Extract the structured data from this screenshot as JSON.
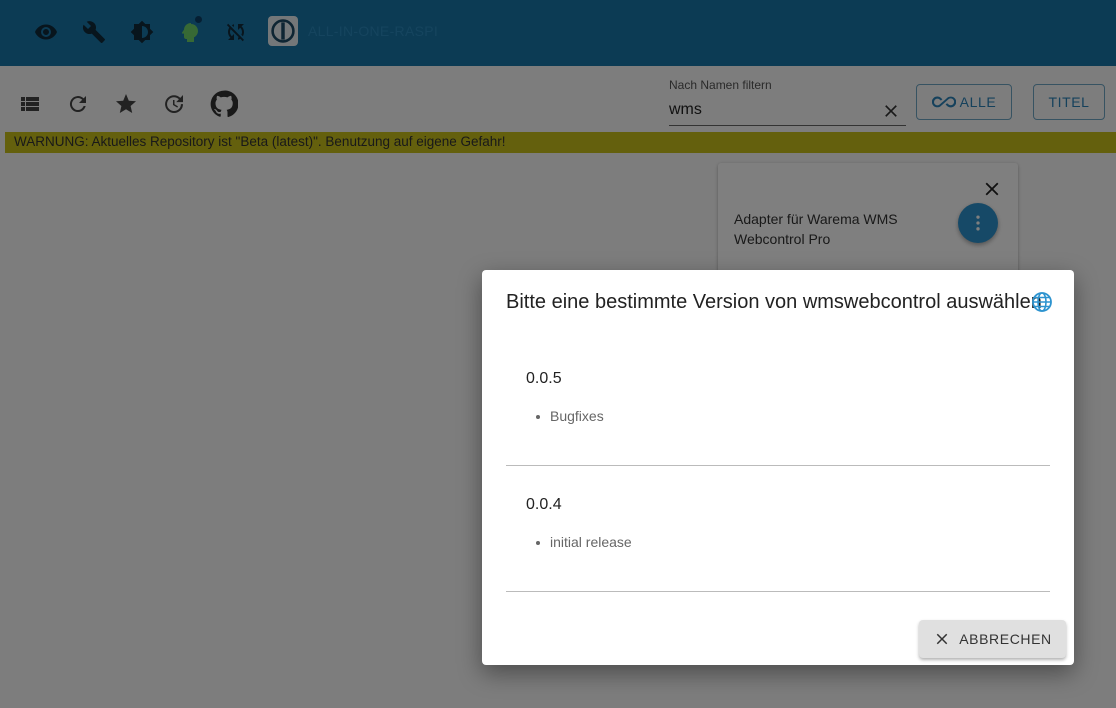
{
  "appbar": {
    "icons": [
      "eye-icon",
      "wrench-icon",
      "brightness-icon",
      "head-icon",
      "sync-off-icon"
    ],
    "host_name": "ALL-IN-ONE-RASPI"
  },
  "toolbar": {
    "icons": [
      "list-icon",
      "refresh-icon",
      "star-icon",
      "update-icon",
      "github-icon"
    ],
    "filter": {
      "label": "Nach Namen filtern",
      "value": "wms"
    },
    "all_button": "ALLE",
    "title_button": "TITEL"
  },
  "warning": "WARNUNG: Aktuelles Repository ist \"Beta (latest)\". Benutzung auf eigene Gefahr!",
  "card": {
    "description": "Adapter für Warema WMS Webcontrol Pro"
  },
  "dialog": {
    "title": "Bitte eine bestimmte Version von wmswebcontrol auswählen",
    "versions": [
      {
        "version": "0.0.5",
        "note": "Bugfixes"
      },
      {
        "version": "0.0.4",
        "note": "initial release"
      }
    ],
    "cancel_label": "ABBRECHEN"
  },
  "colors": {
    "appbar": "#1976a8",
    "warning": "#c8c11a",
    "accent": "#2d93cf"
  }
}
